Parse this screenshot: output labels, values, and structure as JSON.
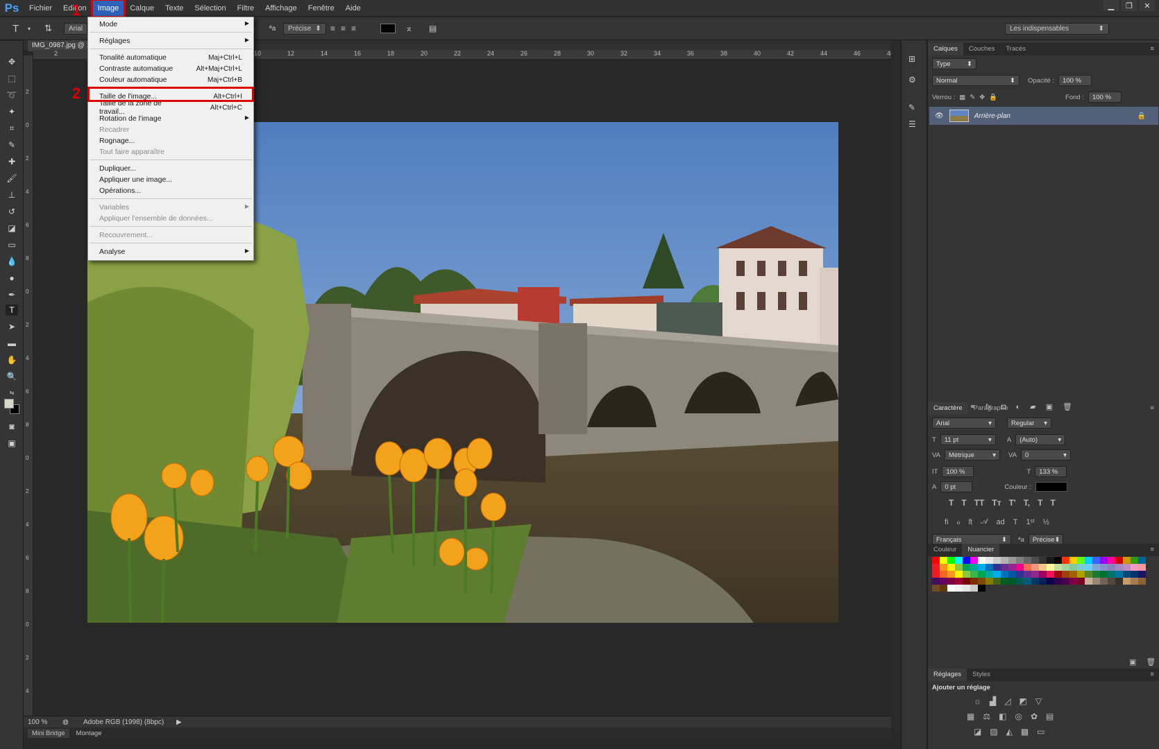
{
  "app": {
    "logo": "Ps"
  },
  "menubar": [
    "Fichier",
    "Edition",
    "Image",
    "Calque",
    "Texte",
    "Sélection",
    "Filtre",
    "Affichage",
    "Fenêtre",
    "Aide"
  ],
  "annotations": {
    "step1": "1",
    "step2": "2"
  },
  "window_controls": [
    "minimize-icon",
    "restore-icon",
    "close-icon"
  ],
  "options_bar": {
    "tool_glyph": "T",
    "font": "Arial",
    "antialias": "Précise",
    "workspace": "Les indispensables",
    "text_color": "#000000"
  },
  "document": {
    "tab_title": "IMG_0987.jpg @ 1",
    "zoom": "100 %",
    "color_profile": "Adobe RGB (1998) (8bpc)"
  },
  "ruler_top": [
    "2",
    "10",
    "12",
    "14",
    "16",
    "18",
    "20",
    "22",
    "24",
    "26",
    "28",
    "30",
    "32",
    "34",
    "36",
    "38",
    "40",
    "42",
    "44",
    "46",
    "48"
  ],
  "ruler_left": [
    "2",
    "0",
    "2",
    "4",
    "6",
    "8",
    "0",
    "2",
    "4",
    "6",
    "8",
    "0",
    "2",
    "4",
    "6",
    "8",
    "0",
    "2",
    "4",
    "6"
  ],
  "bottom_tabs": [
    "Mini Bridge",
    "Montage"
  ],
  "image_menu": [
    {
      "label": "Mode",
      "shortcut": "",
      "submenu": true,
      "disabled": false
    },
    {
      "sep": true
    },
    {
      "label": "Réglages",
      "shortcut": "",
      "submenu": true,
      "disabled": false
    },
    {
      "sep": true
    },
    {
      "label": "Tonalité automatique",
      "shortcut": "Maj+Ctrl+L",
      "disabled": false
    },
    {
      "label": "Contraste automatique",
      "shortcut": "Alt+Maj+Ctrl+L",
      "disabled": false
    },
    {
      "label": "Couleur automatique",
      "shortcut": "Maj+Ctrl+B",
      "disabled": false
    },
    {
      "sep": true
    },
    {
      "label": "Taille de l'image...",
      "shortcut": "Alt+Ctrl+I",
      "disabled": false,
      "highlight": true
    },
    {
      "label": "Taille de la zone de travail...",
      "shortcut": "Alt+Ctrl+C",
      "disabled": false
    },
    {
      "label": "Rotation de l'image",
      "shortcut": "",
      "submenu": true,
      "disabled": false
    },
    {
      "label": "Recadrer",
      "shortcut": "",
      "disabled": true
    },
    {
      "label": "Rognage...",
      "shortcut": "",
      "disabled": false
    },
    {
      "label": "Tout faire apparaître",
      "shortcut": "",
      "disabled": true
    },
    {
      "sep": true
    },
    {
      "label": "Dupliquer...",
      "shortcut": "",
      "disabled": false
    },
    {
      "label": "Appliquer une image...",
      "shortcut": "",
      "disabled": false
    },
    {
      "label": "Opérations...",
      "shortcut": "",
      "disabled": false
    },
    {
      "sep": true
    },
    {
      "label": "Variables",
      "shortcut": "",
      "submenu": true,
      "disabled": true
    },
    {
      "label": "Appliquer l'ensemble de données...",
      "shortcut": "",
      "disabled": true
    },
    {
      "sep": true
    },
    {
      "label": "Recouvrement...",
      "shortcut": "",
      "disabled": true
    },
    {
      "sep": true
    },
    {
      "label": "Analyse",
      "shortcut": "",
      "submenu": true,
      "disabled": false
    }
  ],
  "layers_panel": {
    "tabs": [
      "Calques",
      "Couches",
      "Tracés"
    ],
    "filter": "Type",
    "blend_mode": "Normal",
    "opacity_label": "Opacité :",
    "opacity": "100 %",
    "lock_label": "Verrou :",
    "fill_label": "Fond :",
    "fill": "100 %",
    "layer_name": "Arrière-plan"
  },
  "character_panel": {
    "tabs": [
      "Caractère",
      "Paragraphe"
    ],
    "font": "Arial",
    "style": "Regular",
    "size": "11 pt",
    "leading": "(Auto)",
    "kerning": "Métrique",
    "tracking": "0",
    "vscale": "100 %",
    "hscale": "133 %",
    "baseline": "0 pt",
    "color_label": "Couleur :",
    "language": "Français",
    "antialias": "Précise",
    "type_buttons": [
      "T",
      "T",
      "TT",
      "Tт",
      "T'",
      "T,",
      "T",
      "T"
    ]
  },
  "swatch_panel": {
    "tabs": [
      "Couleur",
      "Nuancier"
    ],
    "colors": [
      "#ff0000",
      "#ffff00",
      "#00ff00",
      "#00ffff",
      "#0000ff",
      "#ff00ff",
      "#ffffff",
      "#e6e6e6",
      "#cccccc",
      "#b3b3b3",
      "#999999",
      "#808080",
      "#666666",
      "#4d4d4d",
      "#333333",
      "#1a1a1a",
      "#000000",
      "#ff3300",
      "#ffcc00",
      "#66ff00",
      "#00ccff",
      "#3366ff",
      "#9900ff",
      "#ff0099",
      "#cc0000",
      "#cc9900",
      "#339900",
      "#006699",
      "#ee1c24",
      "#f7941d",
      "#fff200",
      "#8dc63f",
      "#00a651",
      "#00a99d",
      "#00aeef",
      "#0072bc",
      "#2e3192",
      "#662d91",
      "#92278f",
      "#ec008c",
      "#f26c4f",
      "#f69679",
      "#fdc689",
      "#fff799",
      "#c4df9b",
      "#a3d39c",
      "#82ca9c",
      "#7accc8",
      "#6dcff6",
      "#7da7d9",
      "#8393ca",
      "#8781bd",
      "#a187be",
      "#bd8cbf",
      "#f49ac1",
      "#f5989d",
      "#ed1c24",
      "#f26522",
      "#f7941d",
      "#fff200",
      "#8dc63f",
      "#39b54a",
      "#00a651",
      "#00a99d",
      "#00aeef",
      "#0072bc",
      "#0054a6",
      "#2e3192",
      "#662d91",
      "#92278f",
      "#9e005d",
      "#ed145b",
      "#9e0b0f",
      "#a0410d",
      "#a36209",
      "#aba000",
      "#598527",
      "#197b30",
      "#007236",
      "#00746b",
      "#0076a3",
      "#004a80",
      "#003471",
      "#1b1464",
      "#440e62",
      "#630460",
      "#7b0046",
      "#9e0039",
      "#790000",
      "#7b2e00",
      "#7d4900",
      "#827b00",
      "#406618",
      "#005e20",
      "#005826",
      "#005952",
      "#005b7f",
      "#003663",
      "#002157",
      "#0d004c",
      "#32004b",
      "#4b0049",
      "#7b0046",
      "#7a0026",
      "#c7b299",
      "#998675",
      "#736357",
      "#534741",
      "#37302a",
      "#c69c6d",
      "#a67c52",
      "#8c6239",
      "#754c24",
      "#603913",
      "#ffffff",
      "#f2f2f2",
      "#e6e6e6",
      "#cccccc",
      "#000000",
      "#333333"
    ]
  },
  "adjustments_panel": {
    "tabs": [
      "Réglages",
      "Styles"
    ],
    "title": "Ajouter un réglage"
  }
}
